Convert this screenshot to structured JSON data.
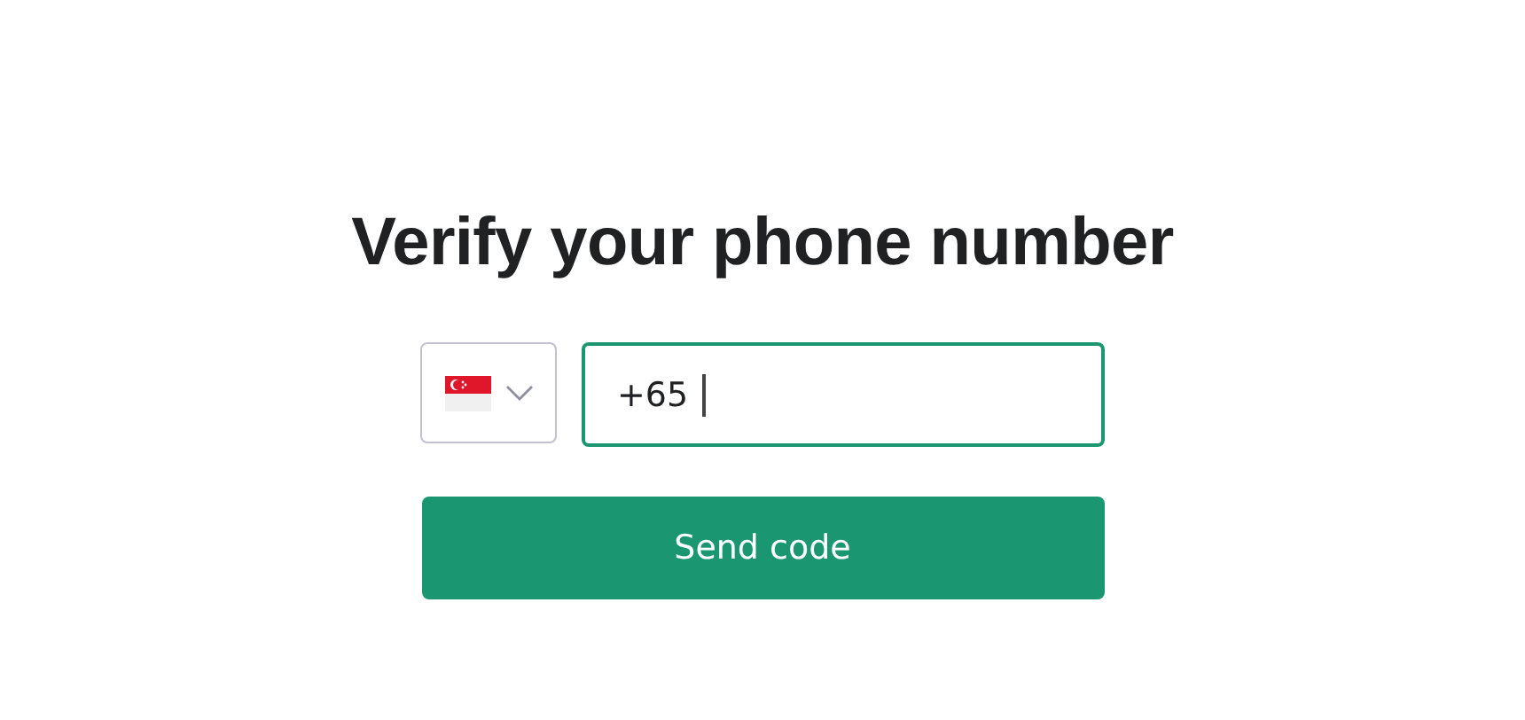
{
  "title": "Verify your phone number",
  "country_select": {
    "expanded": false
  },
  "phone_field": {
    "value": "+65",
    "focused": true
  },
  "submit_button": {
    "label": "Send code"
  }
}
